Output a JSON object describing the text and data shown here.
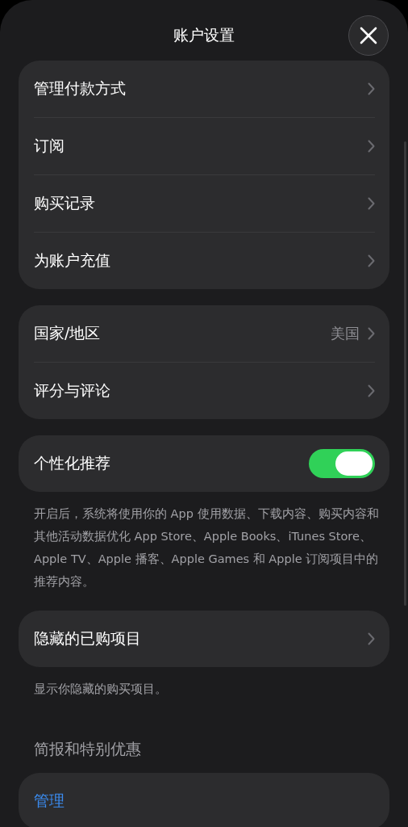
{
  "header": {
    "title": "账户设置"
  },
  "sections": [
    {
      "kind": "list",
      "rows": [
        {
          "label": "管理付款方式"
        },
        {
          "label": "订阅"
        },
        {
          "label": "购买记录"
        },
        {
          "label": "为账户充值"
        }
      ]
    },
    {
      "kind": "list",
      "rows": [
        {
          "label": "国家/地区",
          "value": "美国"
        },
        {
          "label": "评分与评论"
        }
      ]
    },
    {
      "kind": "toggle",
      "label": "个性化推荐",
      "on": true,
      "footer": "开启后，系统将使用你的 App 使用数据、下载内容、购买内容和其他活动数据优化 App Store、Apple Books、iTunes Store、Apple TV、Apple 播客、Apple Games 和 Apple 订阅项目中的推荐内容。"
    },
    {
      "kind": "list",
      "rows": [
        {
          "label": "隐藏的已购项目"
        }
      ],
      "footer": "显示你隐藏的购买项目。"
    },
    {
      "kind": "heading",
      "label": "简报和特别优惠"
    },
    {
      "kind": "link",
      "label": "管理"
    }
  ]
}
